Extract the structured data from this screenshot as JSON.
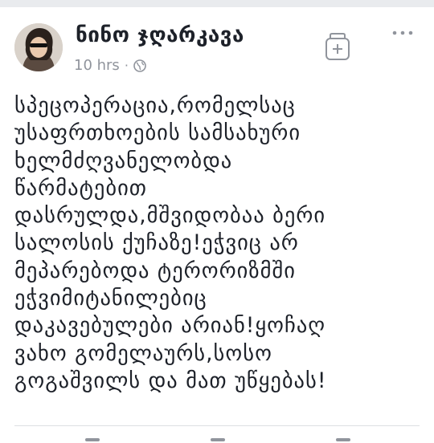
{
  "post": {
    "author_name": "ნინო ჯღარკავა",
    "timestamp": "10 hrs",
    "separator": "·",
    "privacy_icon": "globe-icon",
    "text": "სპეცოპერაცია,რომელსაც\nუსაფრთხოების სამსახური\nხელმძღვანელობდა\nწარმატებით\nდასრულდა,მშვიდობაა ბერი\nსალოსის ქუჩაზე!ეჭვიც არ\nმეპარებოდა ტერორიზმში\nეჭვიმიტანილებიც\nდაკავებულები არიან!ყოჩაღ\nვახო გომელაურს,სოსო\nგოგაშვილს და მათ უწყებას!"
  },
  "actions": {
    "save_icon": "save-icon",
    "more_icon": "more-options-icon"
  },
  "colors": {
    "text": "#1d2129",
    "meta": "#90949c",
    "background": "#ffffff",
    "band": "#e9ebee"
  }
}
